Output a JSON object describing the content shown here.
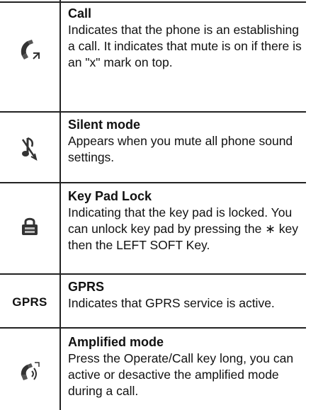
{
  "rows": [
    {
      "icon": "call-handset-icon",
      "title": "Call",
      "desc": "Indicates that the phone is an establishing a call. It indicates that mute is on if there is an \"x\" mark on top."
    },
    {
      "icon": "silent-mode-icon",
      "title": "Silent mode",
      "desc": "Appears when you mute all phone sound settings."
    },
    {
      "icon": "keypad-lock-icon",
      "title": "Key Pad Lock",
      "desc": "Indicating that the key pad is locked. You can unlock key pad by pressing the ∗ key then the LEFT SOFT Key."
    },
    {
      "icon": "gprs-text-icon",
      "icon_text": "GPRS",
      "title": "GPRS",
      "desc": "Indicates that GPRS service is active."
    },
    {
      "icon": "amplified-mode-icon",
      "title": "Amplified mode",
      "desc": "Press the Operate/Call key long, you can active or desactive the amplified mode during a call."
    }
  ]
}
